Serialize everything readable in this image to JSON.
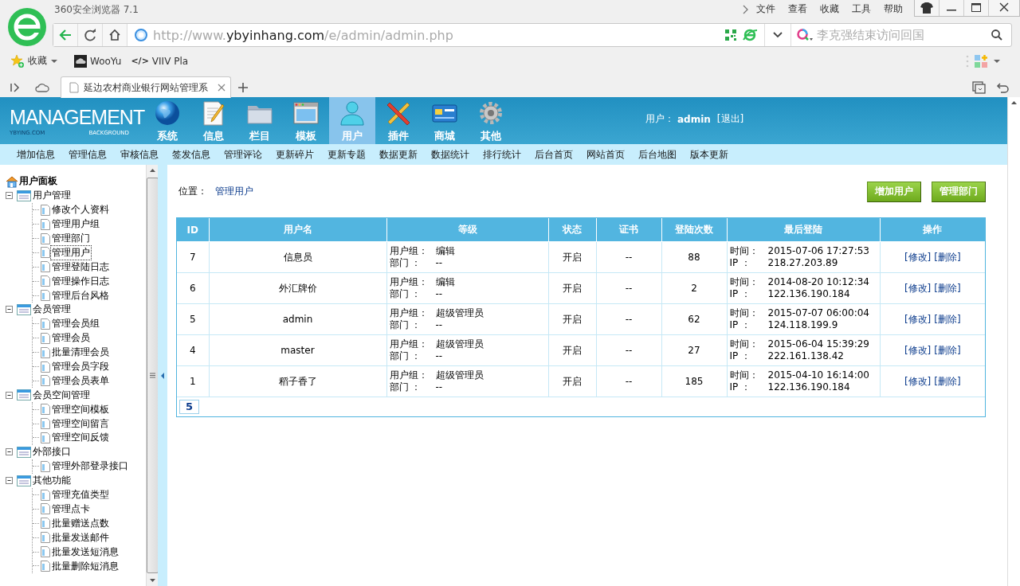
{
  "browser": {
    "title": "360安全浏览器 7.1",
    "menu": [
      "文件",
      "查看",
      "收藏",
      "工具",
      "帮助"
    ],
    "address": {
      "scheme": "http://www.",
      "host": "ybyinhang.com",
      "path": "/e/admin/admin.php"
    },
    "search": {
      "placeholder": "李克强结束访问回国"
    },
    "bookmarks": [
      {
        "kind": "favorites",
        "label": "收藏"
      },
      {
        "kind": "site",
        "label": "WooYu"
      },
      {
        "kind": "code",
        "icon_text": "</>",
        "label": "VIIV Pla"
      }
    ],
    "tabs": [
      {
        "title": "延边农村商业银行网站管理系",
        "selected": true
      }
    ]
  },
  "header": {
    "logo": {
      "title": "MANAGEMENT",
      "left": "YBYING.COM",
      "right": "BACKGROUND"
    },
    "nav": [
      {
        "kind": "globe",
        "label": "系统",
        "selected": false
      },
      {
        "kind": "document",
        "label": "信息",
        "selected": false
      },
      {
        "kind": "folder",
        "label": "栏目",
        "selected": false
      },
      {
        "kind": "window",
        "label": "模板",
        "selected": false
      },
      {
        "kind": "person",
        "label": "用户",
        "selected": true
      },
      {
        "kind": "tools",
        "label": "插件",
        "selected": false
      },
      {
        "kind": "card",
        "label": "商城",
        "selected": false
      },
      {
        "kind": "gear",
        "label": "其他",
        "selected": false
      }
    ],
    "user": {
      "label": "用户：",
      "name": "admin",
      "logout": "[退出]"
    }
  },
  "subnav": [
    "增加信息",
    "管理信息",
    "审核信息",
    "签发信息",
    "管理评论",
    "更新碎片",
    "更新专题",
    "数据更新",
    "数据统计",
    "排行统计",
    "后台首页",
    "网站首页",
    "后台地图",
    "版本更新"
  ],
  "sidebar": {
    "title": "用户面板",
    "groups": [
      {
        "label": "用户管理",
        "expanded": true,
        "children": [
          {
            "label": "修改个人资料",
            "selected": false
          },
          {
            "label": "管理用户组",
            "selected": false
          },
          {
            "label": "管理部门",
            "selected": false
          },
          {
            "label": "管理用户",
            "selected": true
          },
          {
            "label": "管理登陆日志",
            "selected": false
          },
          {
            "label": "管理操作日志",
            "selected": false
          },
          {
            "label": "管理后台风格",
            "selected": false
          }
        ]
      },
      {
        "label": "会员管理",
        "expanded": true,
        "children": [
          {
            "label": "管理会员组",
            "selected": false
          },
          {
            "label": "管理会员",
            "selected": false
          },
          {
            "label": "批量清理会员",
            "selected": false
          },
          {
            "label": "管理会员字段",
            "selected": false
          },
          {
            "label": "管理会员表单",
            "selected": false
          }
        ]
      },
      {
        "label": "会员空间管理",
        "expanded": true,
        "children": [
          {
            "label": "管理空间模板",
            "selected": false
          },
          {
            "label": "管理空间留言",
            "selected": false
          },
          {
            "label": "管理空间反馈",
            "selected": false
          }
        ]
      },
      {
        "label": "外部接口",
        "expanded": true,
        "children": [
          {
            "label": "管理外部登录接口",
            "selected": false
          }
        ]
      },
      {
        "label": "其他功能",
        "expanded": true,
        "children": [
          {
            "label": "管理充值类型",
            "selected": false
          },
          {
            "label": "管理点卡",
            "selected": false
          },
          {
            "label": "批量赠送点数",
            "selected": false
          },
          {
            "label": "批量发送邮件",
            "selected": false
          },
          {
            "label": "批量发送短消息",
            "selected": false
          },
          {
            "label": "批量删除短消息",
            "selected": false
          }
        ]
      }
    ]
  },
  "content": {
    "breadcrumb": {
      "label": "位置：",
      "link": "管理用户"
    },
    "buttons": [
      "增加用户",
      "管理部门"
    ],
    "table": {
      "columns": [
        "ID",
        "用户名",
        "等级",
        "状态",
        "证书",
        "登陆次数",
        "最后登陆",
        "操作"
      ],
      "rows": [
        {
          "id": "7",
          "username": "信息员",
          "level": [
            {
              "label": "用户组：",
              "value": "编辑"
            },
            {
              "label": "部门 ：",
              "value": "--"
            }
          ],
          "status": "开启",
          "certificate": "--",
          "logins": "88",
          "last_login": [
            {
              "label": "时间：",
              "value": "2015-07-06 17:27:53"
            },
            {
              "label": "IP ：",
              "value": "218.27.203.89"
            }
          ],
          "actions": [
            "[修改]",
            "[删除]"
          ]
        },
        {
          "id": "6",
          "username": "外汇牌价",
          "level": [
            {
              "label": "用户组：",
              "value": "编辑"
            },
            {
              "label": "部门 ：",
              "value": "--"
            }
          ],
          "status": "开启",
          "certificate": "--",
          "logins": "2",
          "last_login": [
            {
              "label": "时间：",
              "value": "2014-08-20 10:12:34"
            },
            {
              "label": "IP ：",
              "value": "122.136.190.184"
            }
          ],
          "actions": [
            "[修改]",
            "[删除]"
          ]
        },
        {
          "id": "5",
          "username": "admin",
          "level": [
            {
              "label": "用户组：",
              "value": "超级管理员"
            },
            {
              "label": "部门 ：",
              "value": "--"
            }
          ],
          "status": "开启",
          "certificate": "--",
          "logins": "62",
          "last_login": [
            {
              "label": "时间：",
              "value": "2015-07-07 06:00:04"
            },
            {
              "label": "IP ：",
              "value": "124.118.199.9"
            }
          ],
          "actions": [
            "[修改]",
            "[删除]"
          ]
        },
        {
          "id": "4",
          "username": "master",
          "level": [
            {
              "label": "用户组：",
              "value": "超级管理员"
            },
            {
              "label": "部门 ：",
              "value": "--"
            }
          ],
          "status": "开启",
          "certificate": "--",
          "logins": "27",
          "last_login": [
            {
              "label": "时间：",
              "value": "2015-06-04 15:39:29"
            },
            {
              "label": "IP ：",
              "value": "222.161.138.42"
            }
          ],
          "actions": [
            "[修改]",
            "[删除]"
          ]
        },
        {
          "id": "1",
          "username": "稻子香了",
          "level": [
            {
              "label": "用户组：",
              "value": "超级管理员"
            },
            {
              "label": "部门 ：",
              "value": "--"
            }
          ],
          "status": "开启",
          "certificate": "--",
          "logins": "185",
          "last_login": [
            {
              "label": "时间：",
              "value": "2015-04-10 16:14:00"
            },
            {
              "label": "IP ：",
              "value": "122.136.190.184"
            }
          ],
          "actions": [
            "[修改]",
            "[删除]"
          ]
        }
      ]
    },
    "pager": "5"
  }
}
